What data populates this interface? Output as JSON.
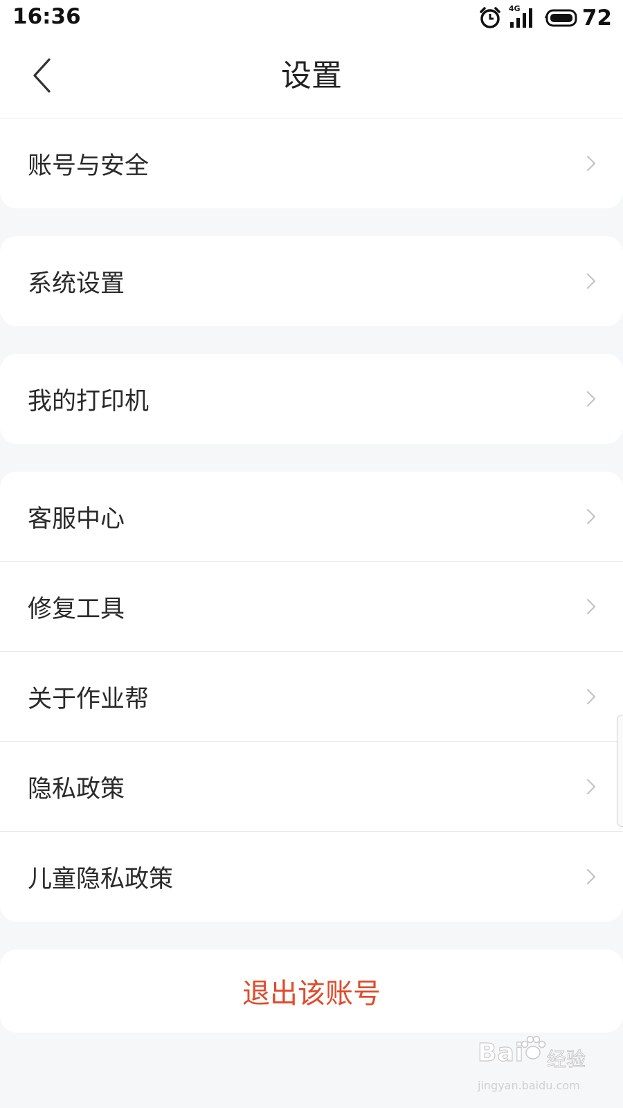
{
  "status_bar": {
    "time": "16:36",
    "network": "4G",
    "battery_percent": "72",
    "icons": [
      "alarm-icon",
      "signal-icon",
      "battery-icon"
    ]
  },
  "header": {
    "title": "设置",
    "back_icon": "back-chevron-icon"
  },
  "settings": {
    "account_security": "账号与安全",
    "system_settings": "系统设置",
    "my_printer": "我的打印机",
    "customer_service": "客服中心",
    "repair_tool": "修复工具",
    "about": "关于作业帮",
    "privacy_policy": "隐私政策",
    "child_privacy_policy": "儿童隐私政策"
  },
  "logout": {
    "label": "退出该账号"
  },
  "watermark": {
    "logo_text": "Bai",
    "logo_text_2": "经验",
    "url": "jingyan.baidu.com"
  },
  "colors": {
    "background": "#f6f7f9",
    "card": "#ffffff",
    "logout_text": "#e04b2b",
    "arrow": "#c4c4c4"
  }
}
